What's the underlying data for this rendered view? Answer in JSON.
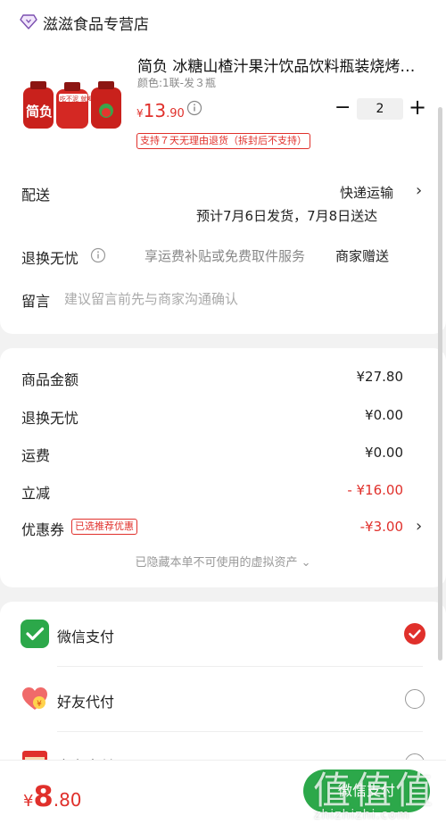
{
  "store": {
    "name": "滋滋食品专营店",
    "icon": "store-diamond-icon"
  },
  "product": {
    "title": "简负 冰糖山楂汁果汁饮品饮料瓶装烧烤…",
    "spec": "颜色:1联-发３瓶",
    "price": {
      "currency": "¥",
      "yuan": "13",
      "cents": ".90"
    },
    "quantity": "2",
    "qty_minus": "−",
    "qty_plus": "+",
    "return_policy": "支持７天无理由退货（拆封后不支持）",
    "image_brand": "简负",
    "image_slogan": "吃不泥 就喝杏"
  },
  "delivery": {
    "label": "配送",
    "method": "快递运输",
    "estimate": "预计7月6日发货，7月8日送达"
  },
  "return_service": {
    "label": "退换无忧",
    "description": "享运费补贴或免费取件服务",
    "value": "商家赠送"
  },
  "message": {
    "label": "留言",
    "placeholder": "建议留言前先与商家沟通确认"
  },
  "summary": {
    "rows": [
      {
        "label": "商品金额",
        "value": "¥27.80"
      },
      {
        "label": "退换无忧",
        "value": "¥0.00"
      },
      {
        "label": "运费",
        "value": "¥0.00"
      },
      {
        "label": "立减",
        "value": "- ¥16.00"
      },
      {
        "label": "优惠券",
        "value": "-¥3.00",
        "tag": "已选推荐优惠"
      }
    ],
    "hidden_assets": "已隐藏本单不可使用的虚拟资产 ⌄"
  },
  "payment": {
    "methods": [
      {
        "label": "微信支付",
        "icon": "wechat-pay-icon",
        "selected": true
      },
      {
        "label": "好友代付",
        "icon": "friend-pay-icon",
        "selected": false
      },
      {
        "label": "京东支付",
        "icon": "card-pay-icon",
        "selected": false
      }
    ]
  },
  "footer": {
    "total": {
      "currency": "¥",
      "yuan": "8",
      "cents": ".80"
    },
    "submit": "微信支付"
  },
  "watermark": {
    "logo": "值值值",
    "site": "zhizhizhi.com"
  },
  "colors": {
    "accent_red": "#e0302b",
    "wechat_green": "#2ca84a",
    "background": "#f2f2f2"
  }
}
